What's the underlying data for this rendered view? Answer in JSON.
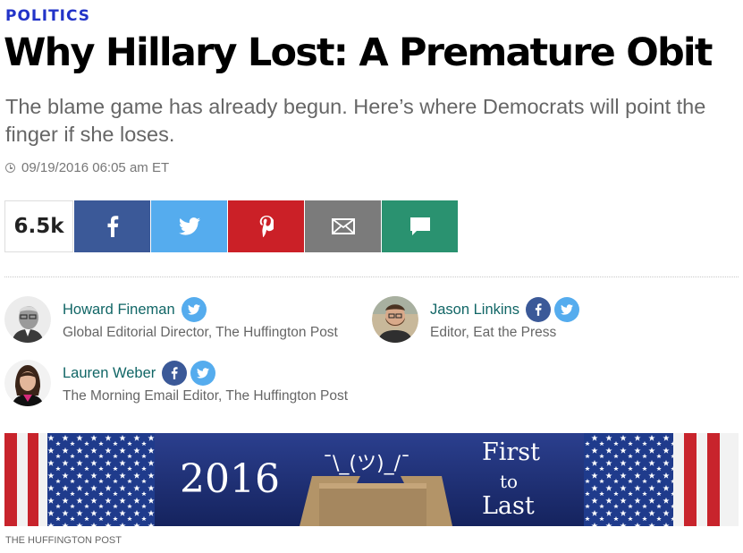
{
  "article": {
    "section": "POLITICS",
    "headline": "Why Hillary Lost: A Premature Obit",
    "subhead": "The blame game has already begun. Here’s where Democrats will point the finger if she loses.",
    "timestamp": "09/19/2016 06:05 am ET"
  },
  "share": {
    "count": "6.5k",
    "buttons": [
      {
        "name": "facebook",
        "icon": "facebook-icon",
        "color": "#3b5998"
      },
      {
        "name": "twitter",
        "icon": "twitter-icon",
        "color": "#55acee"
      },
      {
        "name": "pinterest",
        "icon": "pinterest-icon",
        "color": "#cb2027"
      },
      {
        "name": "email",
        "icon": "email-icon",
        "color": "#7b7b7b"
      },
      {
        "name": "comments",
        "icon": "comment-icon",
        "color": "#2a9270"
      }
    ]
  },
  "authors": [
    {
      "name": "Howard Fineman",
      "title": "Global Editorial Director, The Huffington Post",
      "social": [
        "twitter"
      ]
    },
    {
      "name": "Jason Linkins",
      "title": "Editor, Eat the Press",
      "social": [
        "facebook",
        "twitter"
      ]
    },
    {
      "name": "Lauren Weber",
      "title": "The Morning Email Editor, The Huffington Post",
      "social": [
        "facebook",
        "twitter"
      ]
    }
  ],
  "hero": {
    "year": "2016",
    "shrug": "¯\\_(ツ)_/¯",
    "line1": "First",
    "line2": "to",
    "line3": "Last",
    "caption": "THE HUFFINGTON POST"
  },
  "colors": {
    "section": "#2233c8",
    "author_link": "#116666",
    "hero_bg": "#1d2d6e"
  }
}
